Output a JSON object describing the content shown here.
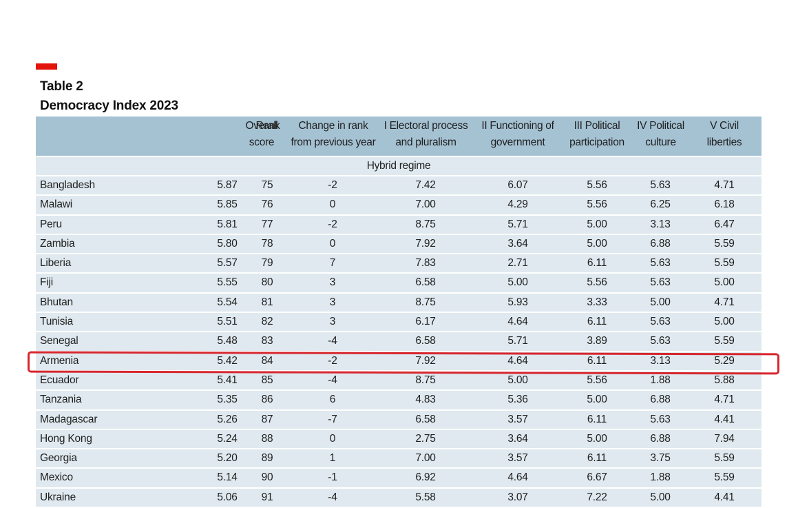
{
  "table_label": "Table 2",
  "table_title": "Democracy Index 2023",
  "columns": [
    "Overall\nscore",
    "Rank",
    "Change in rank\nfrom previous year",
    "I Electoral process\nand pluralism",
    "II Functioning of\ngovernment",
    "III Political\nparticipation",
    "IV Political\nculture",
    "V Civil\nliberties"
  ],
  "group_label": "Hybrid regime",
  "rows": [
    [
      "Bangladesh",
      "5.87",
      "75",
      "-2",
      "7.42",
      "6.07",
      "5.56",
      "5.63",
      "4.71"
    ],
    [
      "Malawi",
      "5.85",
      "76",
      "0",
      "7.00",
      "4.29",
      "5.56",
      "6.25",
      "6.18"
    ],
    [
      "Peru",
      "5.81",
      "77",
      "-2",
      "8.75",
      "5.71",
      "5.00",
      "3.13",
      "6.47"
    ],
    [
      "Zambia",
      "5.80",
      "78",
      "0",
      "7.92",
      "3.64",
      "5.00",
      "6.88",
      "5.59"
    ],
    [
      "Liberia",
      "5.57",
      "79",
      "7",
      "7.83",
      "2.71",
      "6.11",
      "5.63",
      "5.59"
    ],
    [
      "Fiji",
      "5.55",
      "80",
      "3",
      "6.58",
      "5.00",
      "5.56",
      "5.63",
      "5.00"
    ],
    [
      "Bhutan",
      "5.54",
      "81",
      "3",
      "8.75",
      "5.93",
      "3.33",
      "5.00",
      "4.71"
    ],
    [
      "Tunisia",
      "5.51",
      "82",
      "3",
      "6.17",
      "4.64",
      "6.11",
      "5.63",
      "5.00"
    ],
    [
      "Senegal",
      "5.48",
      "83",
      "-4",
      "6.58",
      "5.71",
      "3.89",
      "5.63",
      "5.59"
    ],
    [
      "Armenia",
      "5.42",
      "84",
      "-2",
      "7.92",
      "4.64",
      "6.11",
      "3.13",
      "5.29"
    ],
    [
      "Ecuador",
      "5.41",
      "85",
      "-4",
      "8.75",
      "5.00",
      "5.56",
      "1.88",
      "5.88"
    ],
    [
      "Tanzania",
      "5.35",
      "86",
      "6",
      "4.83",
      "5.36",
      "5.00",
      "6.88",
      "4.71"
    ],
    [
      "Madagascar",
      "5.26",
      "87",
      "-7",
      "6.58",
      "3.57",
      "6.11",
      "5.63",
      "4.41"
    ],
    [
      "Hong Kong",
      "5.24",
      "88",
      "0",
      "2.75",
      "3.64",
      "5.00",
      "6.88",
      "7.94"
    ],
    [
      "Georgia",
      "5.20",
      "89",
      "1",
      "7.00",
      "3.57",
      "6.11",
      "3.75",
      "5.59"
    ],
    [
      "Mexico",
      "5.14",
      "90",
      "-1",
      "6.92",
      "4.64",
      "6.67",
      "1.88",
      "5.59"
    ],
    [
      "Ukraine",
      "5.06",
      "91",
      "-4",
      "5.58",
      "3.07",
      "7.22",
      "5.00",
      "4.41"
    ]
  ],
  "highlighted_country": "Armenia",
  "colors": {
    "accent": "#e3120b",
    "header_bg": "#a5c2d3",
    "row_bg": "#dfe9ef",
    "highlight_outline": "#d7262e"
  }
}
